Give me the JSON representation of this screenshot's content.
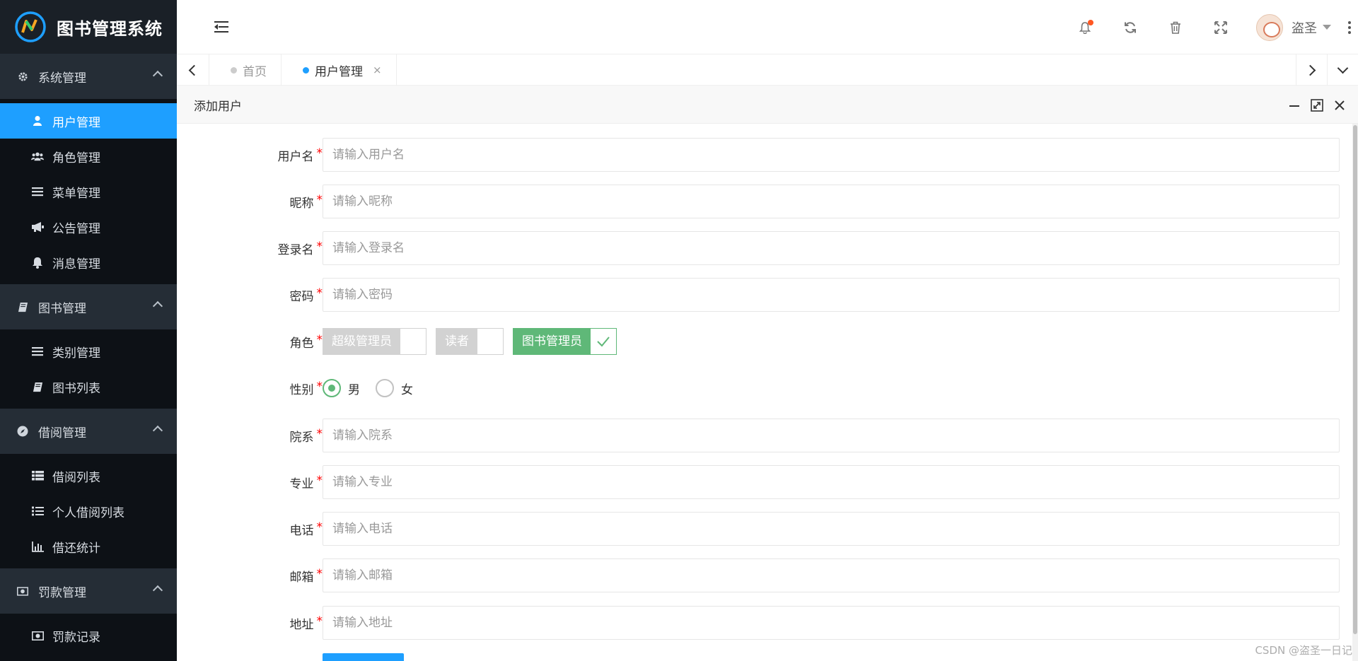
{
  "app": {
    "title": "图书管理系统"
  },
  "sidebar": {
    "groups": [
      {
        "label": "系统管理",
        "icon": "gear-icon",
        "items": [
          {
            "label": "用户管理",
            "icon": "user-icon",
            "active": true
          },
          {
            "label": "角色管理",
            "icon": "users-icon"
          },
          {
            "label": "菜单管理",
            "icon": "list-icon"
          },
          {
            "label": "公告管理",
            "icon": "bullhorn-icon"
          },
          {
            "label": "消息管理",
            "icon": "bell-icon"
          }
        ]
      },
      {
        "label": "图书管理",
        "icon": "book-icon",
        "items": [
          {
            "label": "类别管理",
            "icon": "list-icon"
          },
          {
            "label": "图书列表",
            "icon": "book-icon"
          }
        ]
      },
      {
        "label": "借阅管理",
        "icon": "compass-icon",
        "items": [
          {
            "label": "借阅列表",
            "icon": "table-list-icon"
          },
          {
            "label": "个人借阅列表",
            "icon": "bullet-list-icon"
          },
          {
            "label": "借还统计",
            "icon": "bar-chart-icon"
          }
        ]
      },
      {
        "label": "罚款管理",
        "icon": "money-icon",
        "items": [
          {
            "label": "罚款记录",
            "icon": "money-icon"
          }
        ]
      }
    ]
  },
  "header": {
    "username": "盗圣",
    "notification_color": "#ff5722"
  },
  "tabs": [
    {
      "label": "首页",
      "active": false
    },
    {
      "label": "用户管理",
      "active": true,
      "closable": true,
      "close_glyph": "×"
    }
  ],
  "panel": {
    "title": "添加用户"
  },
  "form": {
    "required_mark": "*",
    "fields": {
      "username": {
        "label": "用户名",
        "placeholder": "请输入用户名"
      },
      "nickname": {
        "label": "昵称",
        "placeholder": "请输入昵称"
      },
      "loginname": {
        "label": "登录名",
        "placeholder": "请输入登录名"
      },
      "password": {
        "label": "密码",
        "placeholder": "请输入密码"
      },
      "department": {
        "label": "院系",
        "placeholder": "请输入院系"
      },
      "major": {
        "label": "专业",
        "placeholder": "请输入专业"
      },
      "phone": {
        "label": "电话",
        "placeholder": "请输入电话"
      },
      "email": {
        "label": "邮箱",
        "placeholder": "请输入邮箱"
      },
      "address": {
        "label": "地址",
        "placeholder": "请输入地址"
      }
    },
    "role": {
      "label": "角色",
      "options": [
        {
          "label": "超级管理员",
          "checked": false
        },
        {
          "label": "读者",
          "checked": false
        },
        {
          "label": "图书管理员",
          "checked": true
        }
      ]
    },
    "gender": {
      "label": "性别",
      "options": [
        {
          "label": "男",
          "checked": true
        },
        {
          "label": "女",
          "checked": false
        }
      ]
    }
  },
  "watermark": "CSDN @盗圣一日记"
}
